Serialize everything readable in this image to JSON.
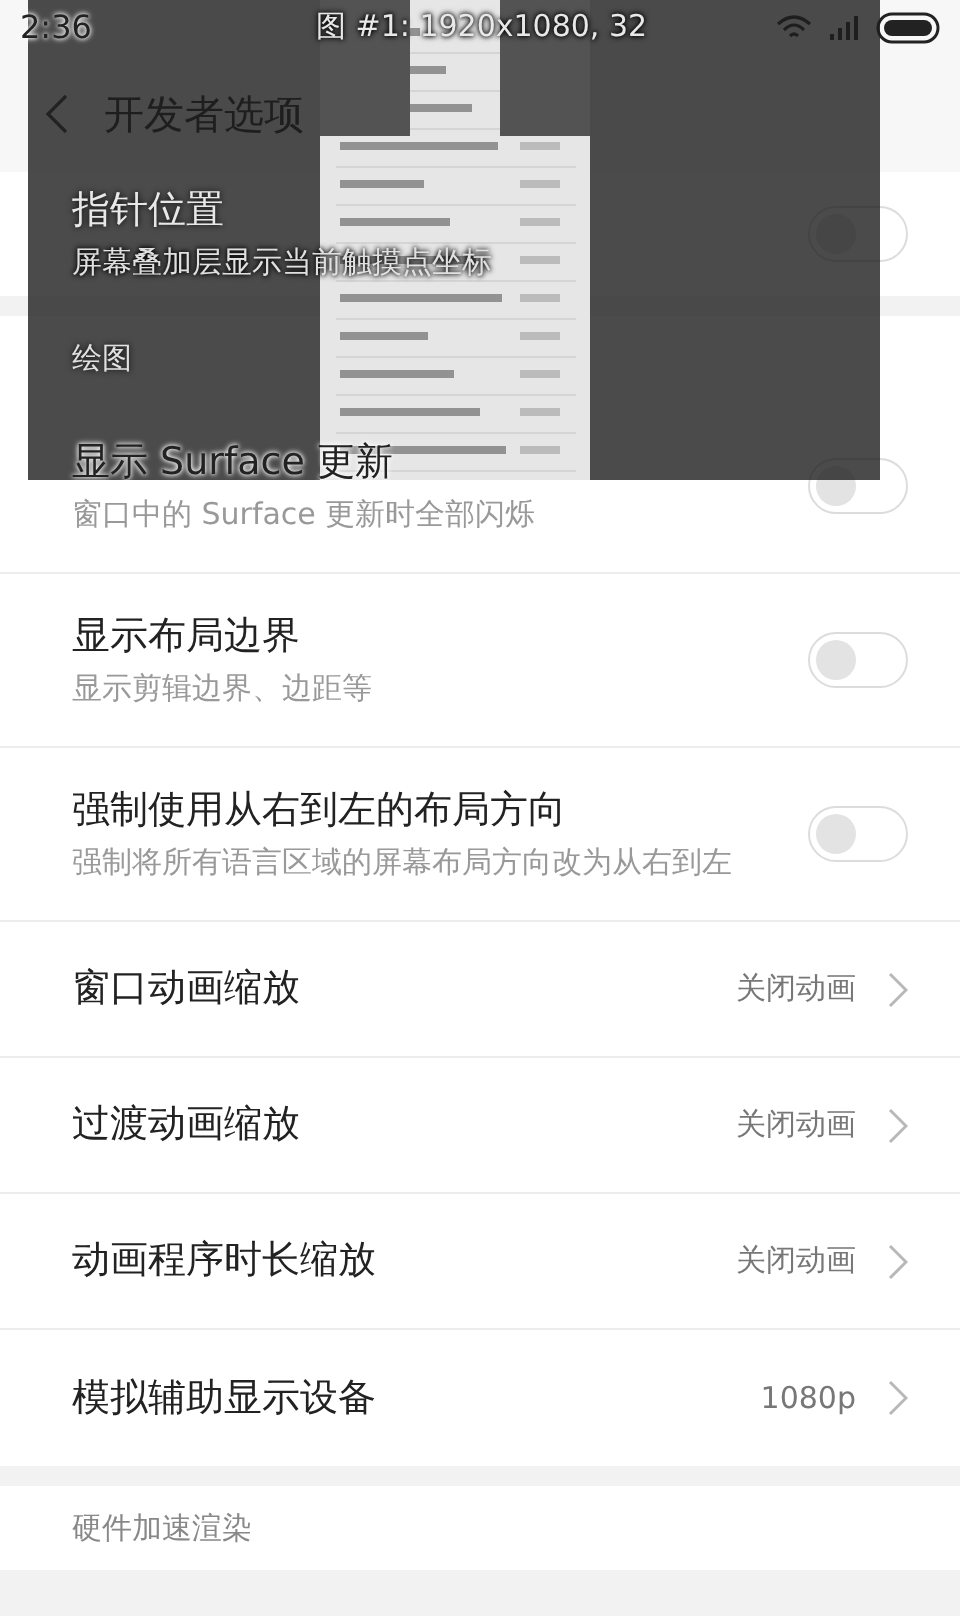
{
  "status_bar": {
    "time": "2:36"
  },
  "header": {
    "title": "开发者选项"
  },
  "sections": [
    {
      "items": [
        {
          "kind": "toggle",
          "title": "指针位置",
          "subtitle": "屏幕叠加层显示当前触摸点坐标",
          "on": false
        }
      ]
    },
    {
      "title": "绘图",
      "items": [
        {
          "kind": "toggle",
          "title": "显示 Surface 更新",
          "subtitle": "窗口中的 Surface 更新时全部闪烁",
          "on": false
        },
        {
          "kind": "toggle",
          "title": "显示布局边界",
          "subtitle": "显示剪辑边界、边距等",
          "on": false
        },
        {
          "kind": "toggle",
          "title": "强制使用从右到左的布局方向",
          "subtitle": "强制将所有语言区域的屏幕布局方向改为从右到左",
          "on": false
        },
        {
          "kind": "link",
          "title": "窗口动画缩放",
          "value": "关闭动画"
        },
        {
          "kind": "link",
          "title": "过渡动画缩放",
          "value": "关闭动画"
        },
        {
          "kind": "link",
          "title": "动画程序时长缩放",
          "value": "关闭动画"
        },
        {
          "kind": "link",
          "title": "模拟辅助显示设备",
          "value": "1080p"
        }
      ]
    },
    {
      "title": "硬件加速渲染"
    }
  ],
  "overlay": {
    "caption": "图 #1: 1920x1080, 32"
  }
}
